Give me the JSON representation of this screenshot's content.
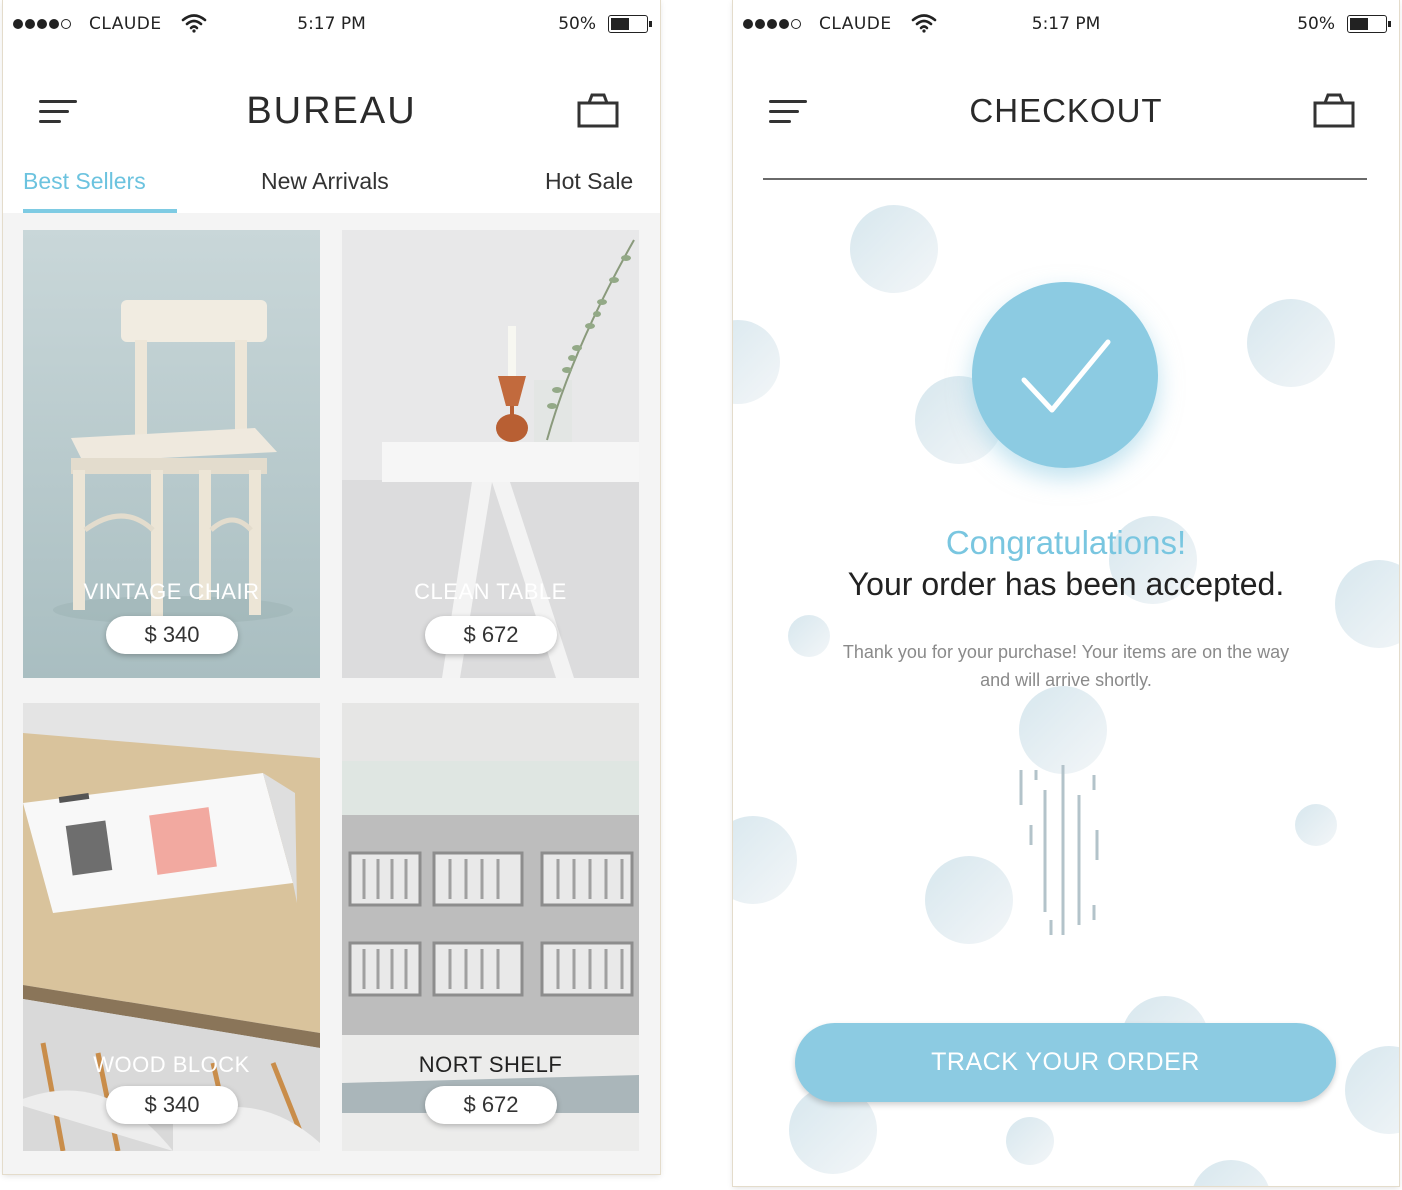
{
  "left_screen": {
    "status": {
      "carrier": "CLAUDE",
      "time": "5:17 PM",
      "battery": "50%"
    },
    "header": {
      "title": "BUREAU",
      "menu_icon": "hamburger-menu-icon",
      "cart_icon": "shopping-bag-icon"
    },
    "tabs": [
      {
        "label": "Best Sellers",
        "active": true
      },
      {
        "label": "New Arrivals",
        "active": false
      },
      {
        "label": "Hot Sale",
        "active": false
      }
    ],
    "products": [
      {
        "name": "VINTAGE CHAIR",
        "price": "$ 340"
      },
      {
        "name": "CLEAN TABLE",
        "price": "$ 672"
      },
      {
        "name": "WOOD BLOCK",
        "price": "$ 340"
      },
      {
        "name": "NORT SHELF",
        "price": "$ 672"
      }
    ]
  },
  "right_screen": {
    "status": {
      "carrier": "CLAUDE",
      "time": "5:17 PM",
      "battery": "50%"
    },
    "header": {
      "title": "CHECKOUT",
      "menu_icon": "hamburger-menu-icon",
      "cart_icon": "shopping-bag-icon"
    },
    "success": {
      "icon": "checkmark-icon",
      "heading": "Congratulations!",
      "subheading": "Your order has been accepted.",
      "message": "Thank you for your purchase! Your items are on the way and will arrive shortly."
    },
    "button_label": "TRACK YOUR ORDER"
  },
  "colors": {
    "accent": "#8ccbe2",
    "accent_text": "#79c6e0",
    "text": "#222222",
    "muted": "#8a8a8a"
  }
}
